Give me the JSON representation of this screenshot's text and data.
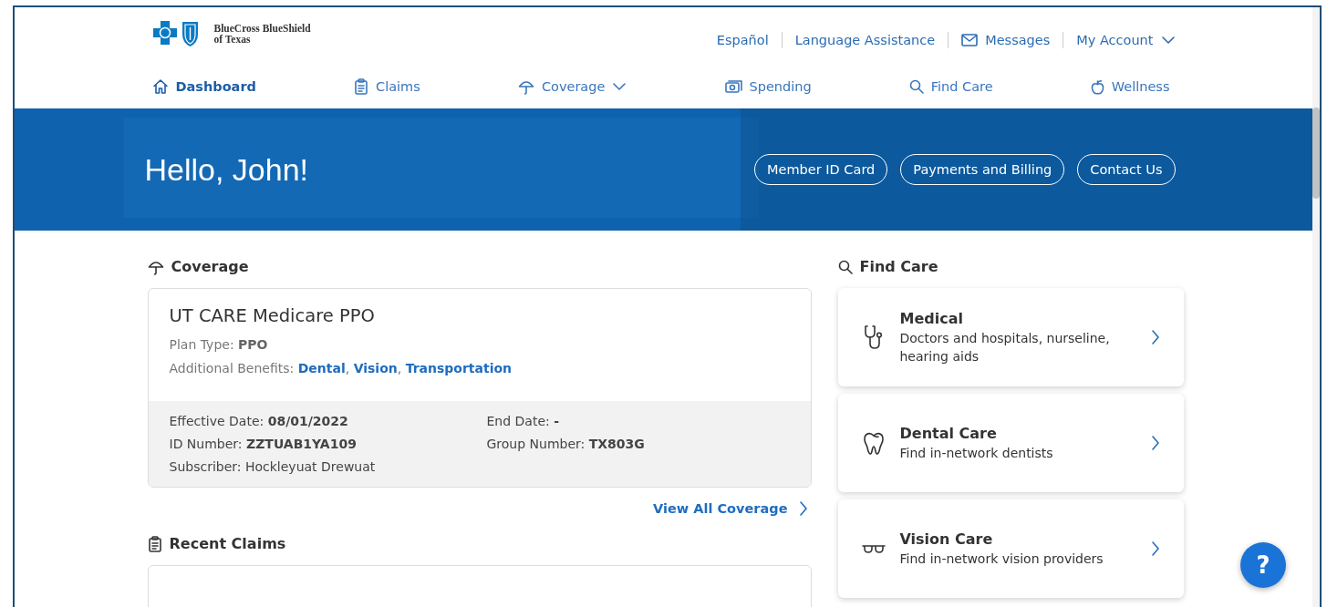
{
  "header": {
    "logo": {
      "line1": "BlueCross BlueShield",
      "line2": "of Texas"
    },
    "utility_links": [
      {
        "label": "Español",
        "kind": "text"
      },
      {
        "label": "Language Assistance",
        "kind": "text"
      },
      {
        "label": "Messages",
        "kind": "messages"
      },
      {
        "label": "My Account",
        "kind": "account"
      }
    ],
    "nav": [
      {
        "label": "Dashboard",
        "kind": "home",
        "selected": true,
        "dropdown": false
      },
      {
        "label": "Claims",
        "kind": "claims",
        "selected": false,
        "dropdown": false
      },
      {
        "label": "Coverage",
        "kind": "coverage",
        "selected": false,
        "dropdown": true
      },
      {
        "label": "Spending",
        "kind": "spending",
        "selected": false,
        "dropdown": false
      },
      {
        "label": "Find Care",
        "kind": "search",
        "selected": false,
        "dropdown": false
      },
      {
        "label": "Wellness",
        "kind": "wellness",
        "selected": false,
        "dropdown": false
      }
    ]
  },
  "hero": {
    "greeting": "Hello, John!",
    "buttons": [
      "Member ID Card",
      "Payments and Billing",
      "Contact Us"
    ]
  },
  "coverage": {
    "heading": "Coverage",
    "plan_name": "UT CARE Medicare PPO",
    "plan_type": "Plan Type: **PPO**",
    "benefits_label": "Additional Benefits:",
    "benefits": [
      "Dental",
      "Vision",
      "Transportation"
    ],
    "benefits_separator": ", ",
    "details": [
      "Effective Date: **08/01/2022**",
      "End Date: **-**",
      "ID Number: **ZZTUAB1YA109**",
      "Group Number: **TX803G**",
      "Subscriber: Hockleyuat Drewuat"
    ],
    "view_all": "View All Coverage"
  },
  "recent_claims": {
    "heading": "Recent Claims"
  },
  "find_care": {
    "heading": "Find Care",
    "items": [
      {
        "kind": "medical",
        "title": "Medical",
        "description": "Doctors and hospitals, nurseline, hearing aids"
      },
      {
        "kind": "dental",
        "title": "Dental Care",
        "description": "Find in-network dentists"
      },
      {
        "kind": "vision",
        "title": "Vision Care",
        "description": "Find in-network vision providers"
      }
    ]
  },
  "help_button": "?"
}
